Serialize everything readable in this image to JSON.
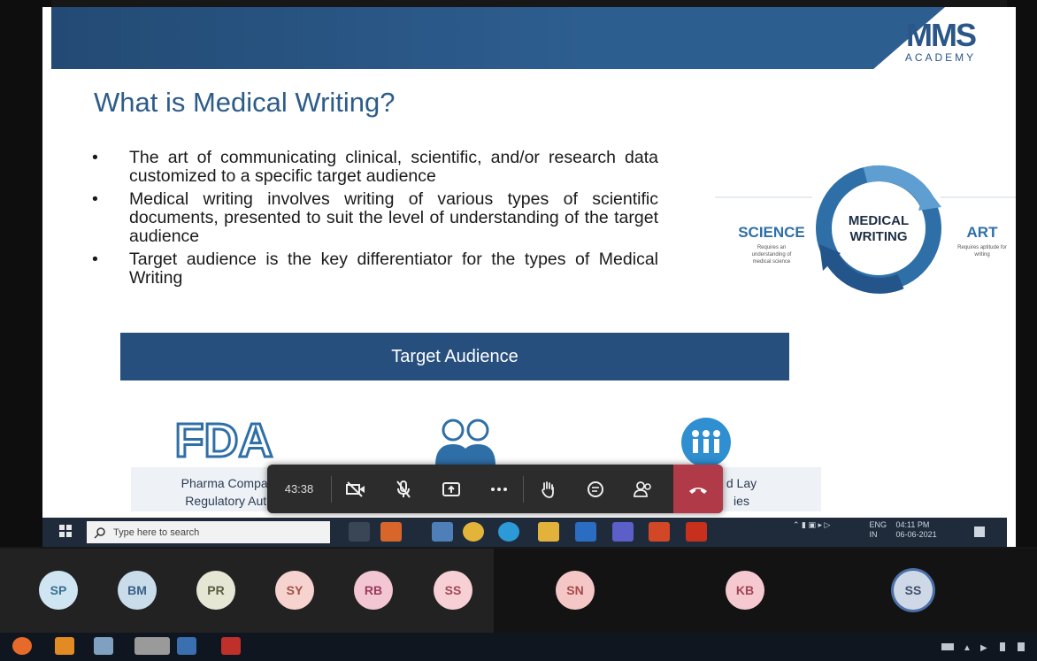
{
  "slide": {
    "title": "What is Medical Writing?",
    "logo_mark": "MMS",
    "logo_sub": "ACADEMY",
    "bullet_glyph": "•",
    "bullets": [
      "The art of communicating clinical, scientific, and/or research data customized to a specific target audience",
      "Medical writing involves writing of various types of scientific documents, presented to suit the level of understanding of the target audience",
      "Target audience is the key differentiator for the types of Medical Writing"
    ],
    "diagram": {
      "center_line1": "MEDICAL",
      "center_line2": "WRITING",
      "left_title": "SCIENCE",
      "left_sub1": "Requires an",
      "left_sub2": "understanding of",
      "left_sub3": "medical science",
      "right_title": "ART",
      "right_sub1": "Requires aptitude for",
      "right_sub2": "writing"
    },
    "target_banner": "Target Audience",
    "fda_text": "FDA",
    "audience_1_line1": "Pharma Companie",
    "audience_1_line2": "Regulatory Autho",
    "audience_3_line1": "d Lay",
    "audience_3_line2": "ies"
  },
  "meeting_controls": {
    "timer": "43:38",
    "buttons": [
      "camera-off",
      "mic-off",
      "share-screen",
      "more",
      "raise-hand",
      "chat",
      "participants",
      "hang-up"
    ]
  },
  "inner_taskbar": {
    "search_placeholder": "Type here to search",
    "lang_top": "ENG",
    "lang_bottom": "IN",
    "time": "04:11 PM",
    "date": "06-06-2021"
  },
  "participants": [
    "SP",
    "BM",
    "PR",
    "SY",
    "RB",
    "SS",
    "SN",
    "KB",
    "SS"
  ],
  "colors": {
    "slide_blue": "#2d5c8a",
    "banner_blue": "#264f7d",
    "hangup_red": "#b03a48",
    "avatar_bg": [
      "#cfe6f2",
      "#c9dcea",
      "#e5e6d4",
      "#f6d3cf",
      "#f3c6d4",
      "#f6d0d5",
      "#f5c6c6",
      "#f6c9d0",
      "#cfd8e6"
    ],
    "avatar_fg": [
      "#3b6f8f",
      "#3c5f86",
      "#5a5c3e",
      "#a44f46",
      "#9b3b5e",
      "#a34656",
      "#a54a4a",
      "#a04456",
      "#40506a"
    ]
  }
}
